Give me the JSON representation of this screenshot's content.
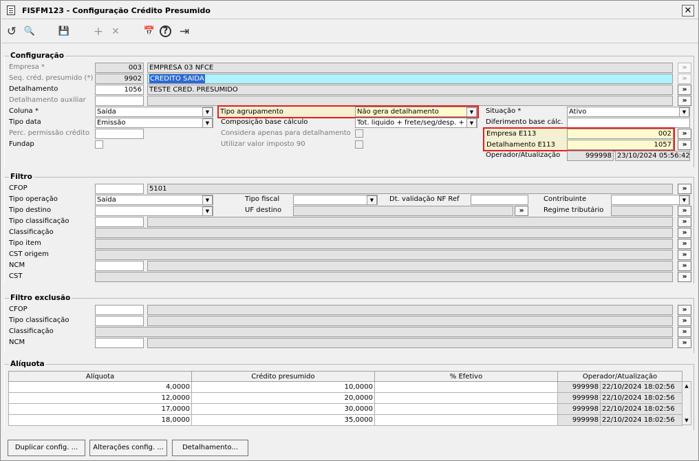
{
  "window": {
    "title": "FISFM123 - Configuração Crédito Presumido",
    "close": "✕"
  },
  "toolbar": {
    "undo": "↺",
    "search": "🔍",
    "save": "💾",
    "add": "+",
    "delete": "✕",
    "calendar": "📅",
    "help": "?",
    "exit": "⇥"
  },
  "config": {
    "title": "Configuração",
    "empresa_label": "Empresa *",
    "empresa_code": "003",
    "empresa_name": "EMPRESA 03 NFCE",
    "seq_label": "Seq. créd. presumido (*)",
    "seq_code": "9902",
    "seq_name": "CREDITO SAIDA",
    "detalhamento_label": "Detalhamento",
    "detalhamento_code": "1056",
    "detalhamento_name": "TESTE CRED. PRESUMIDO",
    "detaux_label": "Detalhamento auxiliar",
    "detaux_value": "",
    "coluna_label": "Coluna *",
    "coluna_value": "Saída",
    "tipodata_label": "Tipo data",
    "tipodata_value": "Emissão",
    "perc_label": "Perc. permissão crédito",
    "perc_value": "",
    "fundap_label": "Fundap",
    "tipoagrup_label": "Tipo agrupamento",
    "tipoagrup_value": "Não gera detalhamento",
    "composicao_label": "Composição base cálculo",
    "composicao_value": "Tot. liquido + frete/seg/desp. + ipi",
    "considera_label": "Considera apenas para detalhamento",
    "utilizar_label": "Utilizar valor imposto 90",
    "situacao_label": "Situação *",
    "situacao_value": "Ativo",
    "diferimento_label": "Diferimento base cálc.",
    "diferimento_value": "",
    "empresa_e113_label": "Empresa E113",
    "empresa_e113_value": "002",
    "det_e113_label": "Detalhamento E113",
    "det_e113_value": "1057",
    "operador_label": "Operador/Atualização",
    "operador_value": "999998",
    "atualizacao_value": "23/10/2024 05:56:42"
  },
  "filtro": {
    "title": "Filtro",
    "cfop_label": "CFOP",
    "cfop_code": "",
    "cfop_value": "5101",
    "tipoop_label": "Tipo operação",
    "tipoop_value": "Saída",
    "tipodest_label": "Tipo destino",
    "tipodest_value": "",
    "tipoclass_label": "Tipo classificação",
    "class_label": "Classificação",
    "tipoitem_label": "Tipo item",
    "cst_origem_label": "CST origem",
    "ncm_label": "NCM",
    "cst_label": "CST",
    "tipofiscal_label": "Tipo fiscal",
    "tipofiscal_value": "",
    "uf_label": "UF destino",
    "dtval_label": "Dt. validação NF Ref",
    "dtval_value": "",
    "contrib_label": "Contribuinte",
    "contrib_value": "",
    "regime_label": "Regime tributário"
  },
  "filtro_exclusao": {
    "title": "Filtro exclusão",
    "cfop_label": "CFOP",
    "tipoclass_label": "Tipo classificação",
    "class_label": "Classificação",
    "ncm_label": "NCM"
  },
  "aliquota": {
    "title": "Alíquota",
    "columns": [
      "Alíquota",
      "Crédito presumido",
      "% Efetivo",
      "Operador/Atualização"
    ],
    "rows": [
      {
        "aliq": "4,0000",
        "cred": "10,0000",
        "efetivo": "",
        "op": "999998",
        "dt": "22/10/2024 18:02:56"
      },
      {
        "aliq": "12,0000",
        "cred": "20,0000",
        "efetivo": "",
        "op": "999998",
        "dt": "22/10/2024 18:02:56"
      },
      {
        "aliq": "17,0000",
        "cred": "30,0000",
        "efetivo": "",
        "op": "999998",
        "dt": "22/10/2024 18:02:56"
      },
      {
        "aliq": "18,0000",
        "cred": "35,0000",
        "efetivo": "",
        "op": "999998",
        "dt": "22/10/2024 18:02:56"
      }
    ]
  },
  "buttons": {
    "duplicar": "Duplicar config. ...",
    "alteracoes": "Alterações config. ...",
    "detalhamento": "Detalhamento..."
  },
  "glyphs": {
    "more": "»",
    "down": "▼",
    "up": "▲"
  }
}
